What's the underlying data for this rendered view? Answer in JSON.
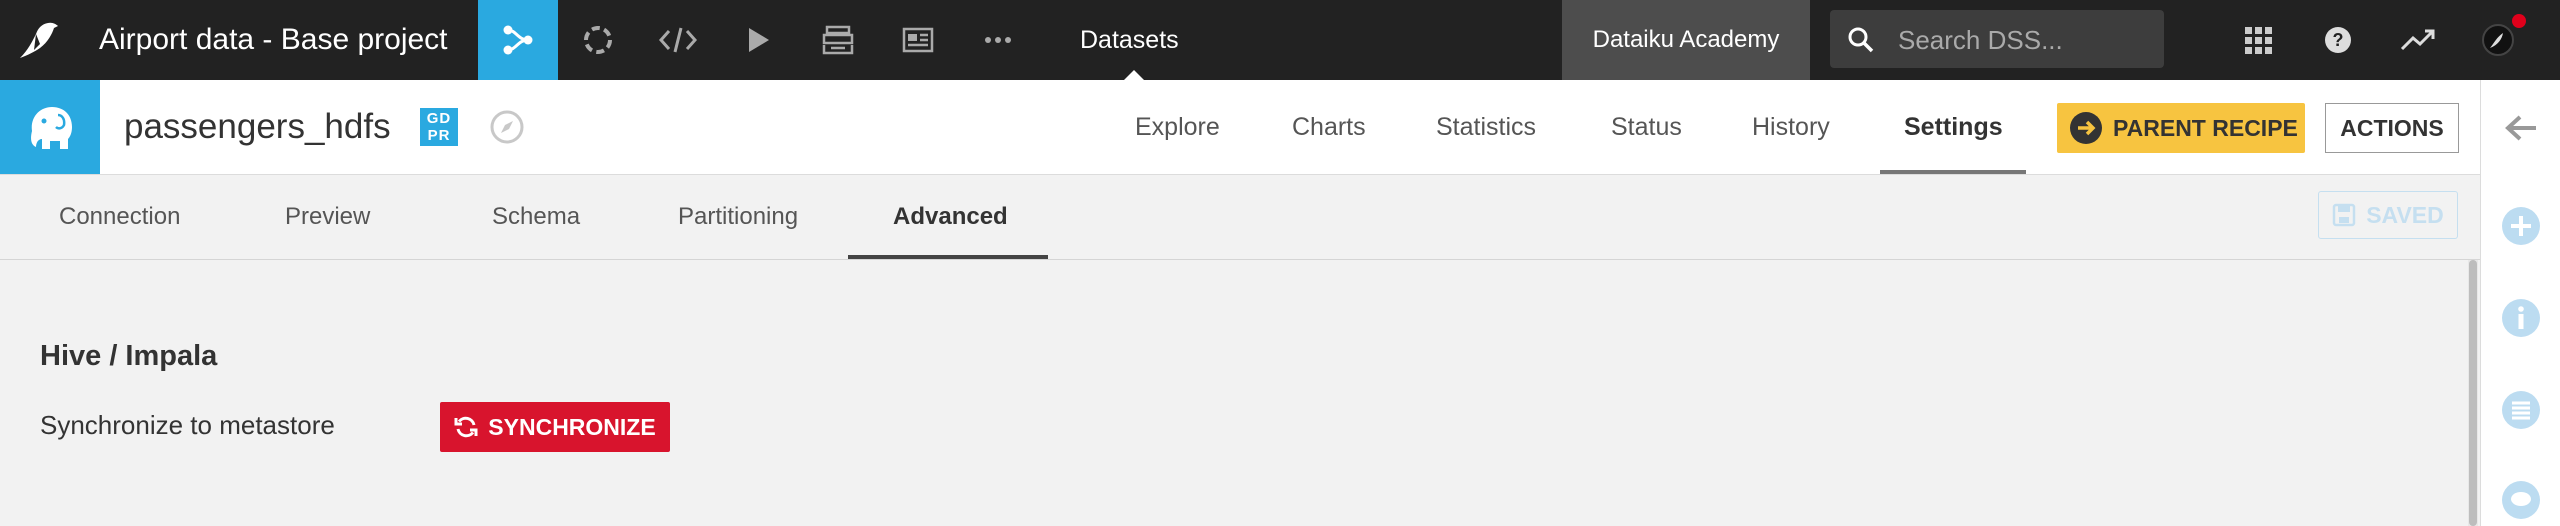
{
  "topbar": {
    "project_title": "Airport data - Base project",
    "datasets_label": "Datasets",
    "academy_label": "Dataiku Academy",
    "search_placeholder": "Search DSS..."
  },
  "dataset": {
    "name": "passengers_hdfs",
    "gdpr_line1": "GD",
    "gdpr_line2": "PR",
    "tabs": [
      "Explore",
      "Charts",
      "Statistics",
      "Status",
      "History",
      "Settings"
    ],
    "active_tab": "Settings",
    "parent_recipe_label": "PARENT RECIPE",
    "actions_label": "ACTIONS"
  },
  "subtabs": {
    "items": [
      "Connection",
      "Preview",
      "Schema",
      "Partitioning",
      "Advanced"
    ],
    "active": "Advanced",
    "saved_label": "SAVED"
  },
  "content": {
    "section_title": "Hive / Impala",
    "sync_label": "Synchronize to metastore",
    "sync_button": "SYNCHRONIZE"
  },
  "colors": {
    "accent": "#2aa9e0",
    "topbar": "#222222",
    "parent_recipe": "#f7c440",
    "danger": "#d8142d"
  }
}
